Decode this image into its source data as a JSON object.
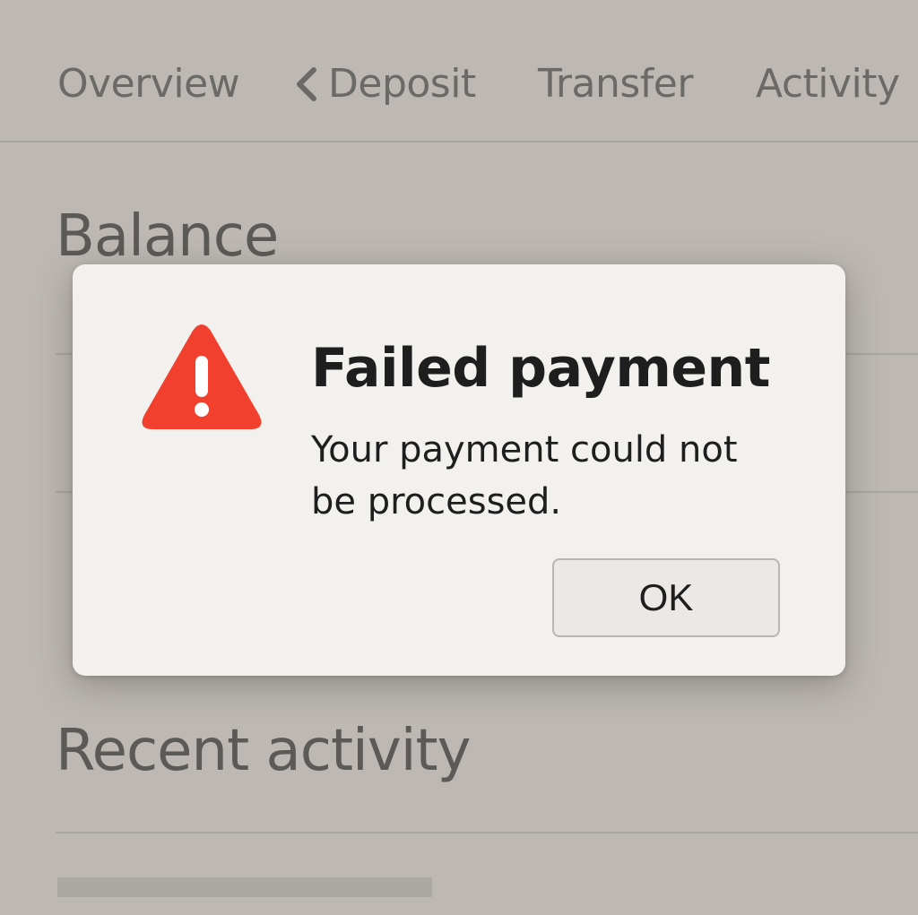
{
  "nav": {
    "items": [
      {
        "label": "Overview"
      },
      {
        "label": "Deposit",
        "icon": "chevron-left-icon"
      },
      {
        "label": "Transfer"
      },
      {
        "label": "Activity"
      }
    ]
  },
  "sections": {
    "balance_title": "Balance",
    "recent_title": "Recent activity"
  },
  "dialog": {
    "icon": "warning-triangle-icon",
    "title": "Failed payment",
    "message": "Your payment could not be processed.",
    "ok_label": "OK"
  },
  "colors": {
    "background": "#bdb8b3",
    "dialog_bg": "#f3f1ee",
    "warning": "#f2402e",
    "text_dark": "#1e1e1e",
    "text_muted": "#6c6a67"
  }
}
